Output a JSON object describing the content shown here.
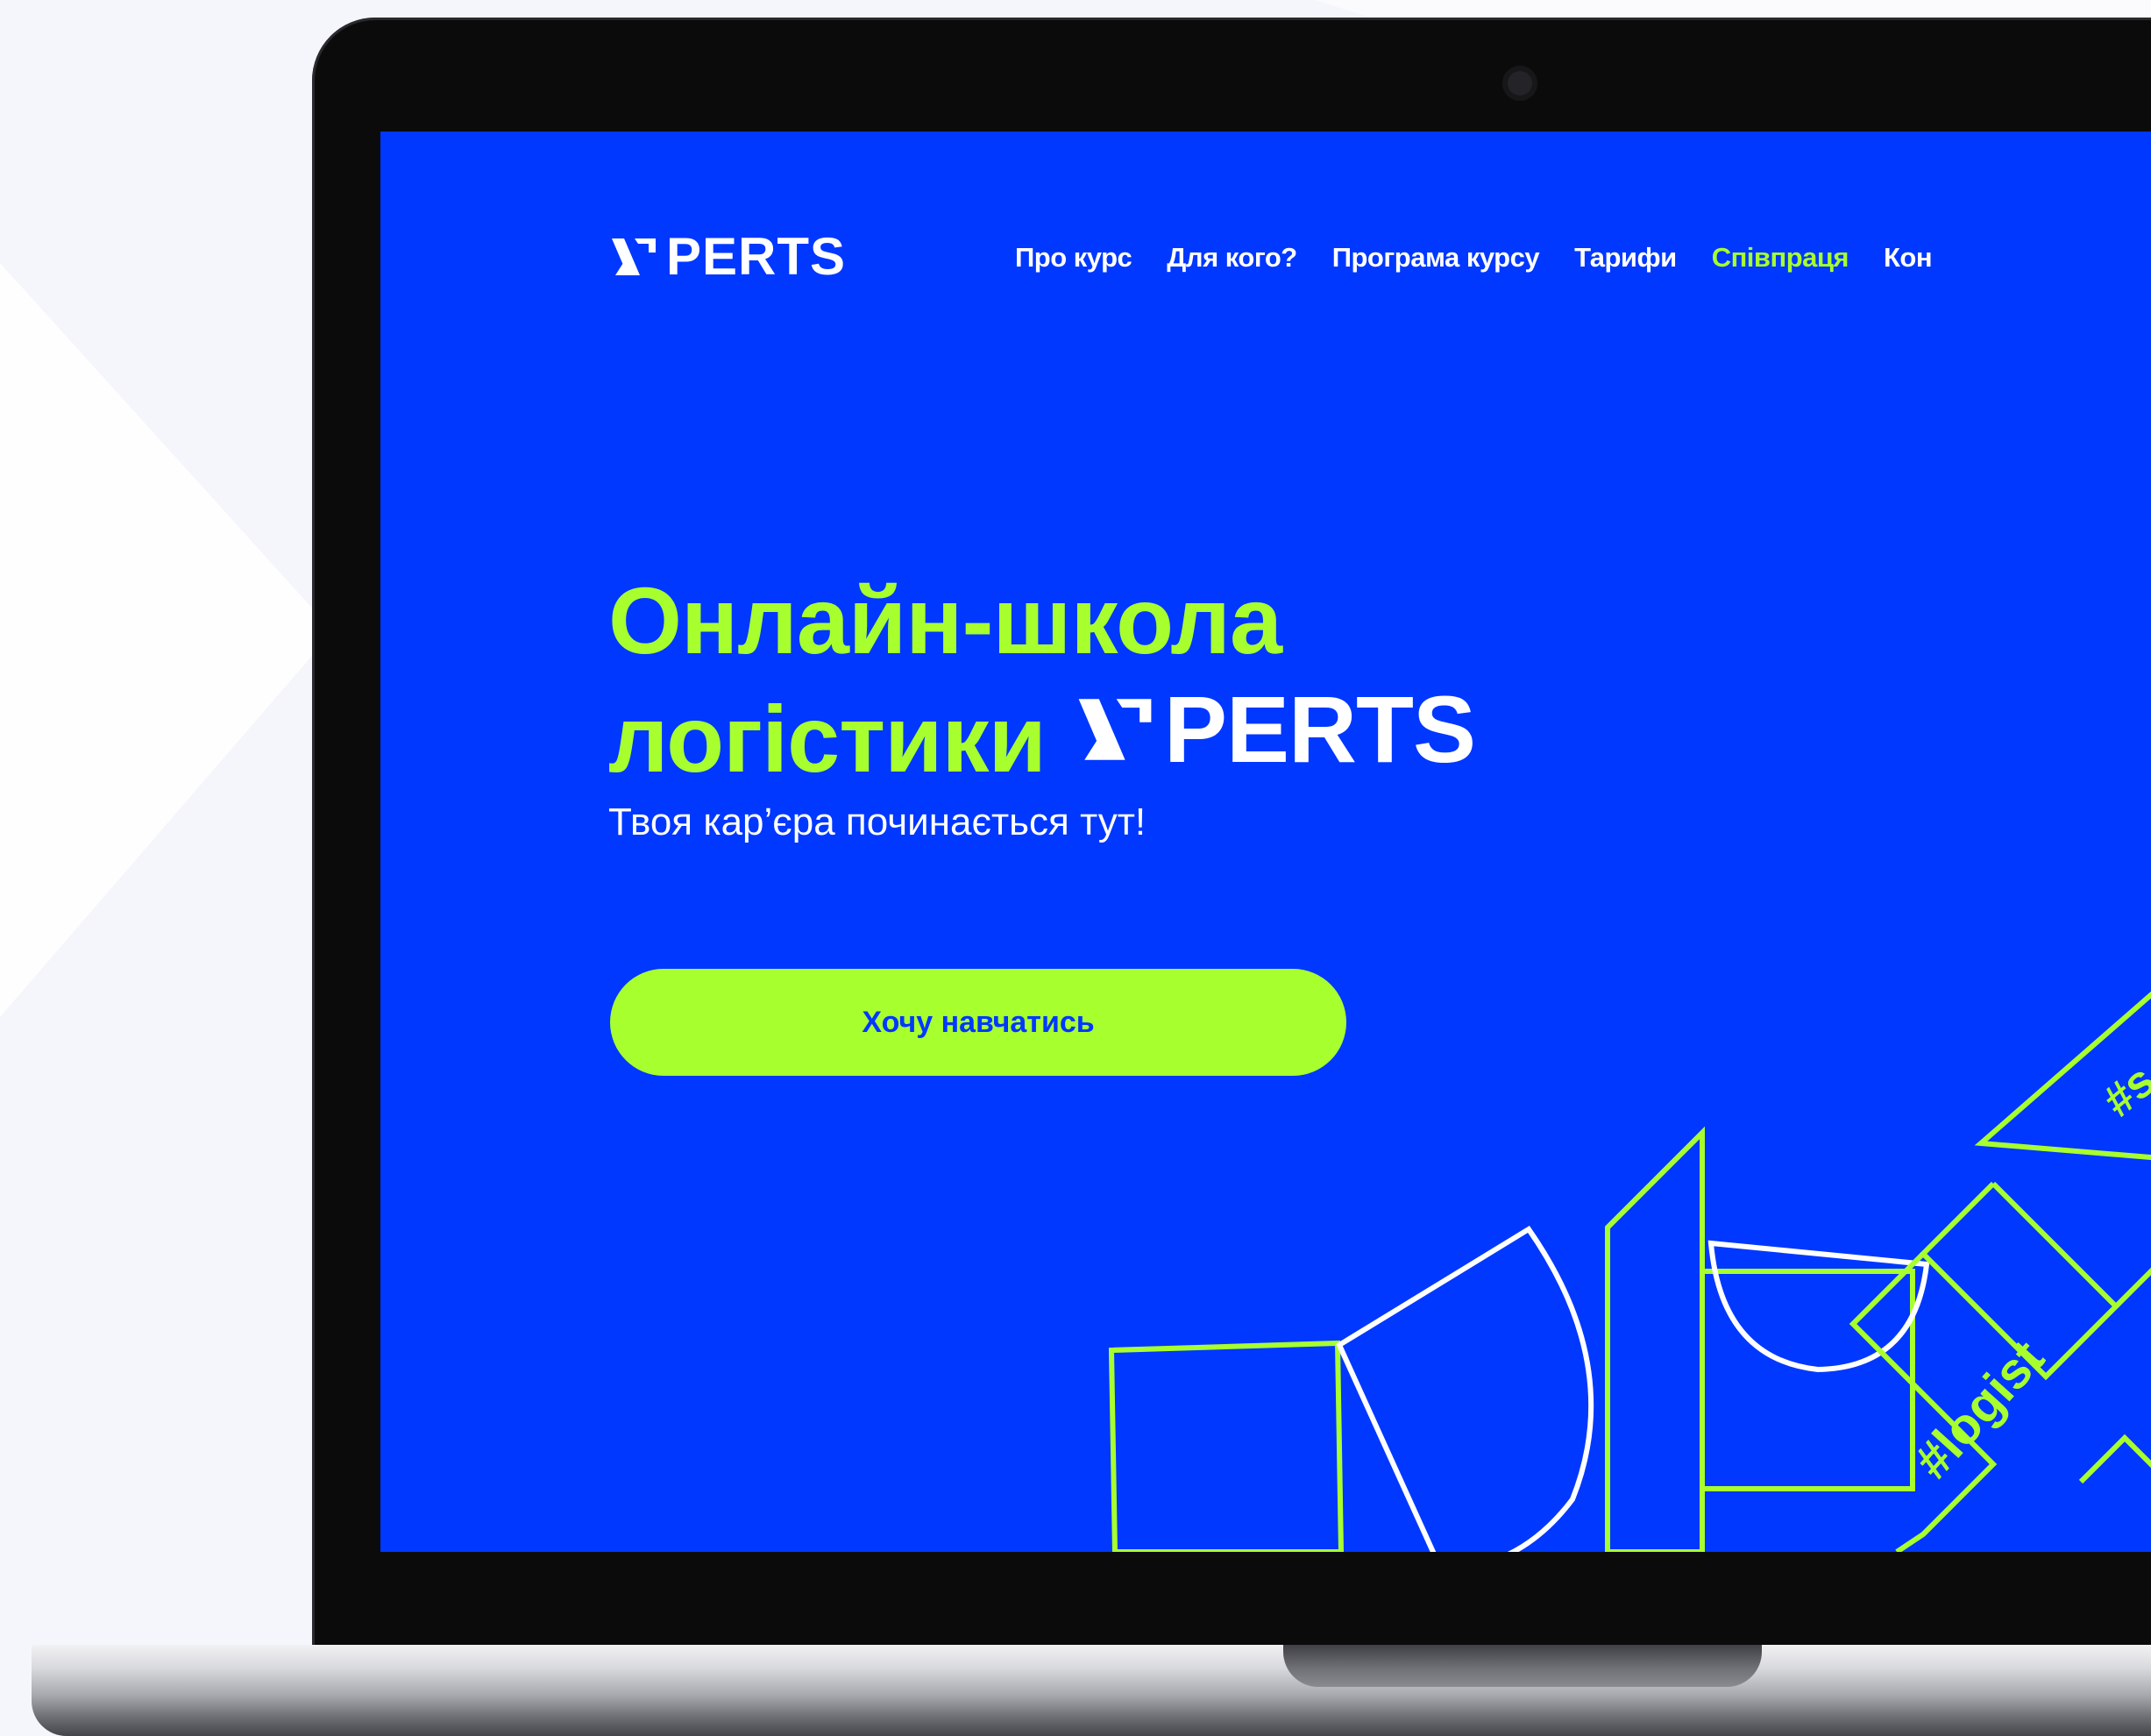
{
  "site": {
    "logo_text": "PERTS",
    "colors": {
      "primary_blue": "#0038ff",
      "accent_green": "#a8ff2e",
      "white": "#ffffff"
    }
  },
  "nav": {
    "items": [
      {
        "label": "Про курс"
      },
      {
        "label": "Для кого?"
      },
      {
        "label": "Програма курсу"
      },
      {
        "label": "Тарифи"
      },
      {
        "label": "Співпраця"
      },
      {
        "label": "Кон"
      }
    ]
  },
  "hero": {
    "title_line1": "Онлайн-школа",
    "title_line2": "логістики",
    "title_brand": "PERTS",
    "subtitle": "Твоя кар’єра починається тут!",
    "cta_label": "Хочу навчатись"
  },
  "decor": {
    "tag1": "#s",
    "tag2": "#logist"
  }
}
